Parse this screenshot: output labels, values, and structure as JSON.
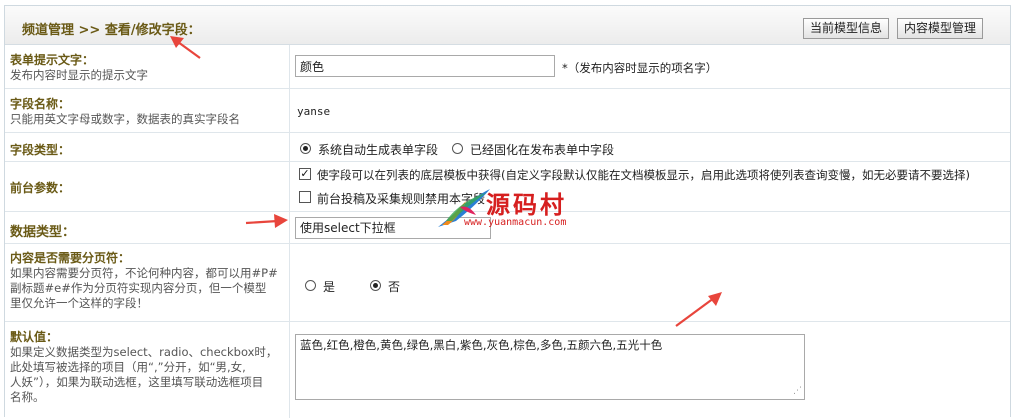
{
  "header": {
    "title": "频道管理 >> 查看/修改字段：",
    "btn_model_info": "当前模型信息",
    "btn_model_manage": "内容模型管理"
  },
  "rows": {
    "form_tip": {
      "label": "表单提示文字：",
      "hint": "发布内容时显示的提示文字",
      "value": "颜色",
      "note": "*（发布内容时显示的项名字）"
    },
    "field_name": {
      "label": "字段名称：",
      "hint": "只能用英文字母或数字，数据表的真实字段名",
      "value": "yanse"
    },
    "field_type": {
      "label": "字段类型：",
      "option1": "系统自动生成表单字段",
      "option2": "已经固化在发布表单中字段"
    },
    "frontend": {
      "label": "前台参数：",
      "check1": "使字段可以在列表的底层模板中获得(自定义字段默认仅能在文档模板显示，启用此选项将使列表查询变慢，如无必要请不要选择)",
      "check2": "前台投稿及采集规则禁用本字段"
    },
    "data_type": {
      "label": "数据类型：",
      "value": "使用select下拉框"
    },
    "paging": {
      "label": "内容是否需要分页符：",
      "hint1": "如果内容需要分页符，不论何种内容，都可以用#P#",
      "hint2": "副标题#e#作为分页符实现内容分页，但一个模型",
      "hint3": "里仅允许一个这样的字段！",
      "yes": "是",
      "no": "否"
    },
    "default": {
      "label": "默认值：",
      "hint1": "如果定义数据类型为select、radio、checkbox时，",
      "hint2": "此处填写被选择的项目（用“,”分开，如“男,女,",
      "hint3": "人妖”），如果为联动选框，这里填写联动选框项目",
      "hint4": "名称。",
      "value": "蓝色,红色,橙色,黄色,绿色,黑白,紫色,灰色,棕色,多色,五颜六色,五光十色"
    }
  },
  "watermark": {
    "cn": "源码村",
    "url": "www.yuanmacun.com"
  },
  "colors": {
    "label": "#6a5a16",
    "arrow": "#e8453c",
    "border": "#dfe6eb"
  }
}
